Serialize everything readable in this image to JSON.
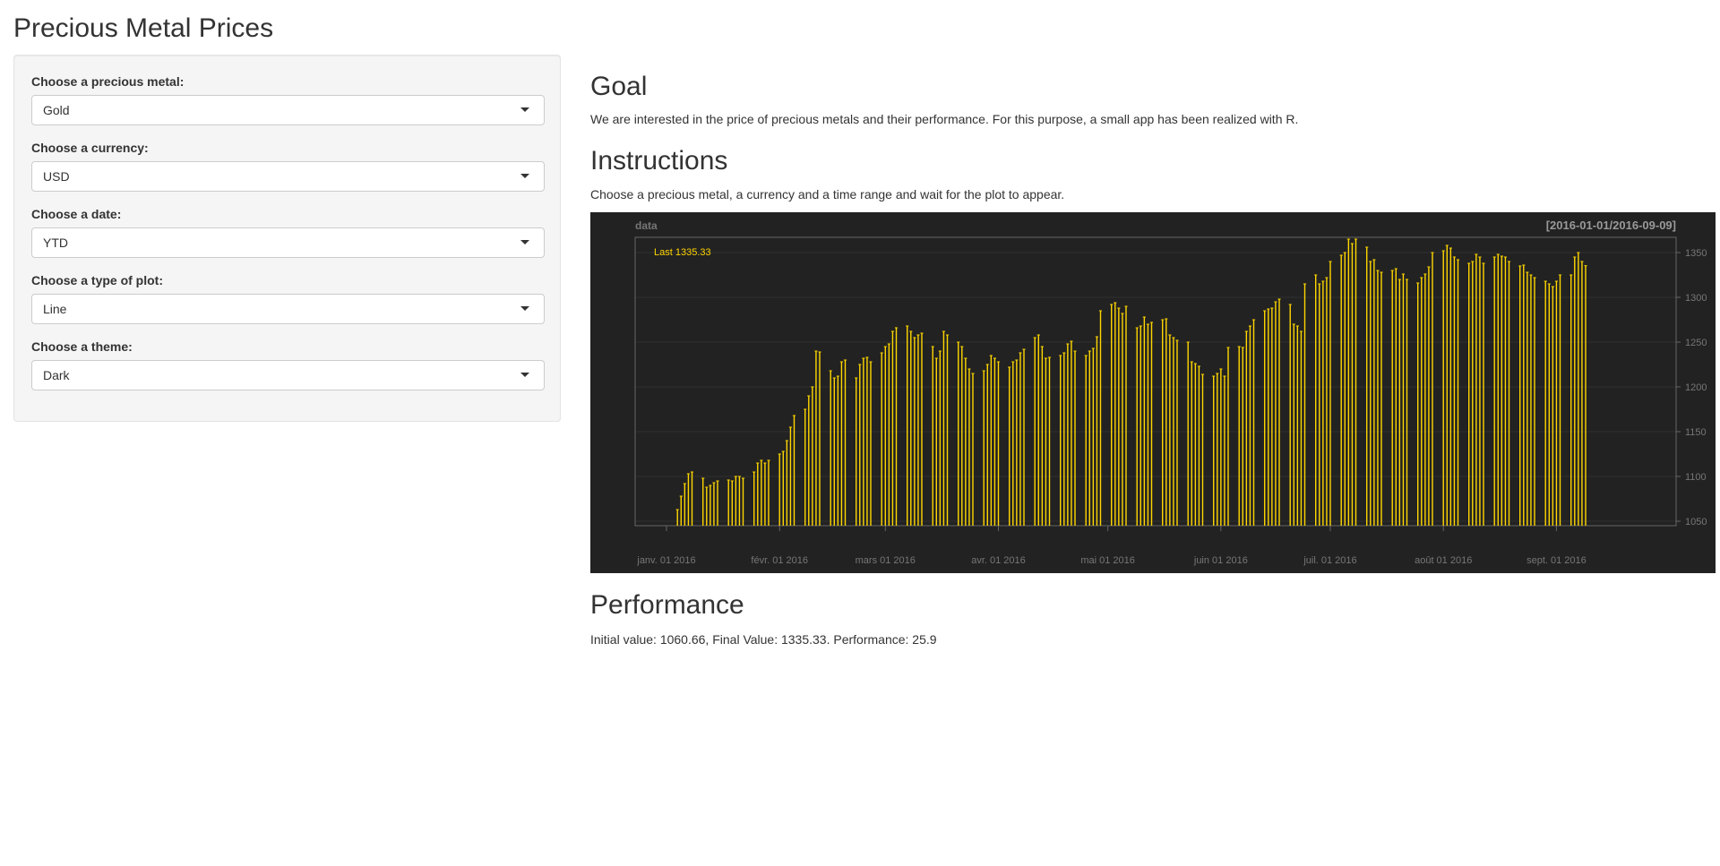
{
  "app": {
    "title": "Precious Metal Prices"
  },
  "sidebar": {
    "fields": [
      {
        "label": "Choose a precious metal:",
        "value": "Gold"
      },
      {
        "label": "Choose a currency:",
        "value": "USD"
      },
      {
        "label": "Choose a date:",
        "value": "YTD"
      },
      {
        "label": "Choose a type of plot:",
        "value": "Line"
      },
      {
        "label": "Choose a theme:",
        "value": "Dark"
      }
    ]
  },
  "main": {
    "goal_heading": "Goal",
    "goal_text": "We are interested in the price of precious metals and their performance. For this purpose, a small app has been realized with R.",
    "instructions_heading": "Instructions",
    "instructions_text": "Choose a precious metal, a currency and a time range and wait for the plot to appear.",
    "performance_heading": "Performance",
    "performance_text": "Initial value: 1060.66, Final Value: 1335.33. Performance: 25.9"
  },
  "colors": {
    "chart_background": "#222222",
    "series": "#FFD700",
    "axis_text": "#888888"
  },
  "chart_data": {
    "type": "bar",
    "title": "data",
    "range_label": "[2016-01-01/2016-09-09]",
    "last_label": "Last 1335.33",
    "x_tick_labels": [
      "janv. 01 2016",
      "févr. 01 2016",
      "mars 01 2016",
      "avr. 01 2016",
      "mai 01 2016",
      "juin 01 2016",
      "juil. 01 2016",
      "août 01 2016",
      "sept. 01 2016"
    ],
    "x_tick_dates": [
      "2016-01-01",
      "2016-02-01",
      "2016-03-01",
      "2016-04-01",
      "2016-05-01",
      "2016-06-01",
      "2016-07-01",
      "2016-08-01",
      "2016-09-01"
    ],
    "x_range": [
      "2016-01-01",
      "2016-09-09"
    ],
    "ylim": [
      1045,
      1367
    ],
    "y_ticks": [
      1050,
      1100,
      1150,
      1200,
      1250,
      1300,
      1350
    ],
    "y_axis_side": "right",
    "grid": true,
    "series": [
      {
        "name": "data",
        "points": [
          [
            "2016-01-04",
            1063
          ],
          [
            "2016-01-05",
            1078
          ],
          [
            "2016-01-06",
            1092
          ],
          [
            "2016-01-07",
            1103
          ],
          [
            "2016-01-08",
            1105
          ],
          [
            "2016-01-11",
            1098
          ],
          [
            "2016-01-12",
            1088
          ],
          [
            "2016-01-13",
            1090
          ],
          [
            "2016-01-14",
            1093
          ],
          [
            "2016-01-15",
            1095
          ],
          [
            "2016-01-18",
            1096
          ],
          [
            "2016-01-19",
            1095
          ],
          [
            "2016-01-20",
            1100
          ],
          [
            "2016-01-21",
            1100
          ],
          [
            "2016-01-22",
            1098
          ],
          [
            "2016-01-25",
            1105
          ],
          [
            "2016-01-26",
            1115
          ],
          [
            "2016-01-27",
            1118
          ],
          [
            "2016-01-28",
            1115
          ],
          [
            "2016-01-29",
            1118
          ],
          [
            "2016-02-01",
            1125
          ],
          [
            "2016-02-02",
            1128
          ],
          [
            "2016-02-03",
            1140
          ],
          [
            "2016-02-04",
            1155
          ],
          [
            "2016-02-05",
            1168
          ],
          [
            "2016-02-08",
            1175
          ],
          [
            "2016-02-09",
            1190
          ],
          [
            "2016-02-10",
            1200
          ],
          [
            "2016-02-11",
            1240
          ],
          [
            "2016-02-12",
            1239
          ],
          [
            "2016-02-15",
            1218
          ],
          [
            "2016-02-16",
            1210
          ],
          [
            "2016-02-17",
            1212
          ],
          [
            "2016-02-18",
            1228
          ],
          [
            "2016-02-19",
            1230
          ],
          [
            "2016-02-22",
            1210
          ],
          [
            "2016-02-23",
            1225
          ],
          [
            "2016-02-24",
            1232
          ],
          [
            "2016-02-25",
            1233
          ],
          [
            "2016-02-26",
            1228
          ],
          [
            "2016-02-29",
            1238
          ],
          [
            "2016-03-01",
            1245
          ],
          [
            "2016-03-02",
            1248
          ],
          [
            "2016-03-03",
            1262
          ],
          [
            "2016-03-04",
            1266
          ],
          [
            "2016-03-07",
            1268
          ],
          [
            "2016-03-08",
            1262
          ],
          [
            "2016-03-09",
            1255
          ],
          [
            "2016-03-10",
            1258
          ],
          [
            "2016-03-11",
            1260
          ],
          [
            "2016-03-14",
            1245
          ],
          [
            "2016-03-15",
            1232
          ],
          [
            "2016-03-16",
            1240
          ],
          [
            "2016-03-17",
            1262
          ],
          [
            "2016-03-18",
            1258
          ],
          [
            "2016-03-21",
            1250
          ],
          [
            "2016-03-22",
            1245
          ],
          [
            "2016-03-23",
            1232
          ],
          [
            "2016-03-24",
            1220
          ],
          [
            "2016-03-25",
            1215
          ],
          [
            "2016-03-28",
            1218
          ],
          [
            "2016-03-29",
            1225
          ],
          [
            "2016-03-30",
            1235
          ],
          [
            "2016-03-31",
            1232
          ],
          [
            "2016-04-01",
            1228
          ],
          [
            "2016-04-04",
            1222
          ],
          [
            "2016-04-05",
            1228
          ],
          [
            "2016-04-06",
            1230
          ],
          [
            "2016-04-07",
            1238
          ],
          [
            "2016-04-08",
            1242
          ],
          [
            "2016-04-11",
            1255
          ],
          [
            "2016-04-12",
            1258
          ],
          [
            "2016-04-13",
            1245
          ],
          [
            "2016-04-14",
            1232
          ],
          [
            "2016-04-15",
            1233
          ],
          [
            "2016-04-18",
            1235
          ],
          [
            "2016-04-19",
            1238
          ],
          [
            "2016-04-20",
            1248
          ],
          [
            "2016-04-21",
            1251
          ],
          [
            "2016-04-22",
            1240
          ],
          [
            "2016-04-25",
            1235
          ],
          [
            "2016-04-26",
            1240
          ],
          [
            "2016-04-27",
            1243
          ],
          [
            "2016-04-28",
            1256
          ],
          [
            "2016-04-29",
            1285
          ],
          [
            "2016-05-02",
            1292
          ],
          [
            "2016-05-03",
            1294
          ],
          [
            "2016-05-04",
            1288
          ],
          [
            "2016-05-05",
            1282
          ],
          [
            "2016-05-06",
            1290
          ],
          [
            "2016-05-09",
            1266
          ],
          [
            "2016-05-10",
            1268
          ],
          [
            "2016-05-11",
            1278
          ],
          [
            "2016-05-12",
            1270
          ],
          [
            "2016-05-13",
            1272
          ],
          [
            "2016-05-16",
            1275
          ],
          [
            "2016-05-17",
            1276
          ],
          [
            "2016-05-18",
            1258
          ],
          [
            "2016-05-19",
            1255
          ],
          [
            "2016-05-20",
            1252
          ],
          [
            "2016-05-23",
            1250
          ],
          [
            "2016-05-24",
            1228
          ],
          [
            "2016-05-25",
            1226
          ],
          [
            "2016-05-26",
            1223
          ],
          [
            "2016-05-27",
            1214
          ],
          [
            "2016-05-30",
            1212
          ],
          [
            "2016-05-31",
            1215
          ],
          [
            "2016-06-01",
            1220
          ],
          [
            "2016-06-02",
            1212
          ],
          [
            "2016-06-03",
            1244
          ],
          [
            "2016-06-06",
            1245
          ],
          [
            "2016-06-07",
            1244
          ],
          [
            "2016-06-08",
            1262
          ],
          [
            "2016-06-09",
            1268
          ],
          [
            "2016-06-10",
            1275
          ],
          [
            "2016-06-13",
            1285
          ],
          [
            "2016-06-14",
            1287
          ],
          [
            "2016-06-15",
            1288
          ],
          [
            "2016-06-16",
            1295
          ],
          [
            "2016-06-17",
            1298
          ],
          [
            "2016-06-20",
            1292
          ],
          [
            "2016-06-21",
            1270
          ],
          [
            "2016-06-22",
            1268
          ],
          [
            "2016-06-23",
            1262
          ],
          [
            "2016-06-24",
            1315
          ],
          [
            "2016-06-27",
            1325
          ],
          [
            "2016-06-28",
            1315
          ],
          [
            "2016-06-29",
            1318
          ],
          [
            "2016-06-30",
            1322
          ],
          [
            "2016-07-01",
            1340
          ],
          [
            "2016-07-04",
            1347
          ],
          [
            "2016-07-05",
            1350
          ],
          [
            "2016-07-06",
            1365
          ],
          [
            "2016-07-07",
            1360
          ],
          [
            "2016-07-08",
            1365
          ],
          [
            "2016-07-11",
            1356
          ],
          [
            "2016-07-12",
            1340
          ],
          [
            "2016-07-13",
            1342
          ],
          [
            "2016-07-14",
            1330
          ],
          [
            "2016-07-15",
            1328
          ],
          [
            "2016-07-18",
            1330
          ],
          [
            "2016-07-19",
            1332
          ],
          [
            "2016-07-20",
            1320
          ],
          [
            "2016-07-21",
            1326
          ],
          [
            "2016-07-22",
            1320
          ],
          [
            "2016-07-25",
            1316
          ],
          [
            "2016-07-26",
            1322
          ],
          [
            "2016-07-27",
            1326
          ],
          [
            "2016-07-28",
            1334
          ],
          [
            "2016-07-29",
            1350
          ],
          [
            "2016-08-01",
            1352
          ],
          [
            "2016-08-02",
            1358
          ],
          [
            "2016-08-03",
            1355
          ],
          [
            "2016-08-04",
            1345
          ],
          [
            "2016-08-05",
            1342
          ],
          [
            "2016-08-08",
            1338
          ],
          [
            "2016-08-09",
            1340
          ],
          [
            "2016-08-10",
            1348
          ],
          [
            "2016-08-11",
            1345
          ],
          [
            "2016-08-12",
            1338
          ],
          [
            "2016-08-15",
            1345
          ],
          [
            "2016-08-16",
            1348
          ],
          [
            "2016-08-17",
            1346
          ],
          [
            "2016-08-18",
            1345
          ],
          [
            "2016-08-19",
            1340
          ],
          [
            "2016-08-22",
            1335
          ],
          [
            "2016-08-23",
            1336
          ],
          [
            "2016-08-24",
            1328
          ],
          [
            "2016-08-25",
            1325
          ],
          [
            "2016-08-26",
            1322
          ],
          [
            "2016-08-29",
            1318
          ],
          [
            "2016-08-30",
            1315
          ],
          [
            "2016-08-31",
            1312
          ],
          [
            "2016-09-01",
            1318
          ],
          [
            "2016-09-02",
            1325
          ],
          [
            "2016-09-05",
            1325
          ],
          [
            "2016-09-06",
            1345
          ],
          [
            "2016-09-07",
            1350
          ],
          [
            "2016-09-08",
            1340
          ],
          [
            "2016-09-09",
            1335.33
          ]
        ]
      }
    ]
  }
}
